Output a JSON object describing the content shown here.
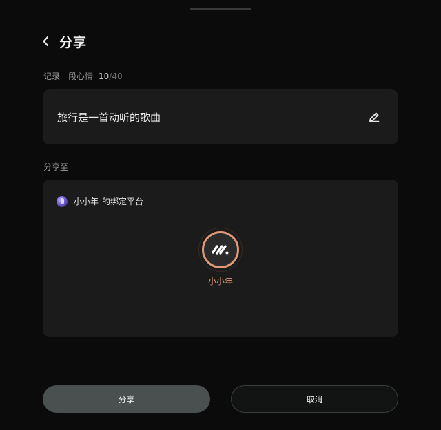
{
  "header": {
    "title": "分享",
    "back_icon": "chevron-left-icon"
  },
  "note": {
    "label": "记录一段心情",
    "count_current": "10",
    "count_max": "/40",
    "text": "旅行是一首动听的歌曲",
    "edit_icon": "pencil-icon"
  },
  "share_to": {
    "label": "分享至",
    "user_name": "小小年",
    "user_suffix": "的绑定平台",
    "platforms": [
      {
        "name": "小小年",
        "icon": "platform-logo-icon",
        "selected": true
      }
    ]
  },
  "actions": {
    "share_label": "分享",
    "cancel_label": "取消"
  },
  "colors": {
    "background": "#0b0b0b",
    "card": "#1b1b1b",
    "accent": "#e09a77",
    "share_button": "#4a4f50"
  }
}
